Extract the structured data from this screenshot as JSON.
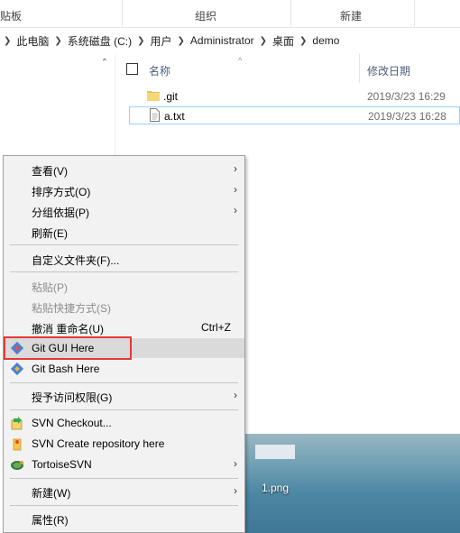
{
  "ribbon": {
    "groups": [
      "贴板",
      "组织",
      "新建"
    ]
  },
  "address": {
    "crumbs": [
      "此电脑",
      "系统磁盘 (C:)",
      "用户",
      "Administrator",
      "桌面",
      "demo"
    ]
  },
  "nav": {
    "scroll_up": "⌃"
  },
  "columns": {
    "name": "名称",
    "date_modified": "修改日期",
    "sort_indicator": "^"
  },
  "files": [
    {
      "name": ".git",
      "date": "2019/3/23 16:29",
      "icon": "folder-icon"
    },
    {
      "name": "a.txt",
      "date": "2019/3/23 16:28",
      "icon": "text-file-icon"
    }
  ],
  "desktop": {
    "file_label": "1.png"
  },
  "context_menu": {
    "items": [
      {
        "label": "查看(V)",
        "submenu": "›"
      },
      {
        "label": "排序方式(O)",
        "submenu": "›"
      },
      {
        "label": "分组依据(P)",
        "submenu": "›"
      },
      {
        "label": "刷新(E)"
      },
      {
        "label": "自定义文件夹(F)..."
      },
      {
        "label": "粘贴(P)"
      },
      {
        "label": "粘贴快捷方式(S)"
      },
      {
        "label": "撤消 重命名(U)",
        "shortcut": "Ctrl+Z"
      },
      {
        "label": "Git GUI Here",
        "icon": "git-gui-icon"
      },
      {
        "label": "Git Bash Here",
        "icon": "git-bash-icon"
      },
      {
        "label": "授予访问权限(G)",
        "submenu": "›"
      },
      {
        "label": "SVN Checkout...",
        "icon": "svn-checkout-icon"
      },
      {
        "label": "SVN Create repository here",
        "icon": "svn-create-repo-icon"
      },
      {
        "label": "TortoiseSVN",
        "icon": "tortoisesvn-icon",
        "submenu": "›"
      },
      {
        "label": "新建(W)",
        "submenu": "›"
      },
      {
        "label": "属性(R)"
      }
    ]
  },
  "colors": {
    "menu_bg": "#f2f2f2",
    "menu_highlight": "#dadada",
    "annotation_box": "#e53935",
    "selection_border": "#99d1ff",
    "header_text": "#4c607a"
  }
}
